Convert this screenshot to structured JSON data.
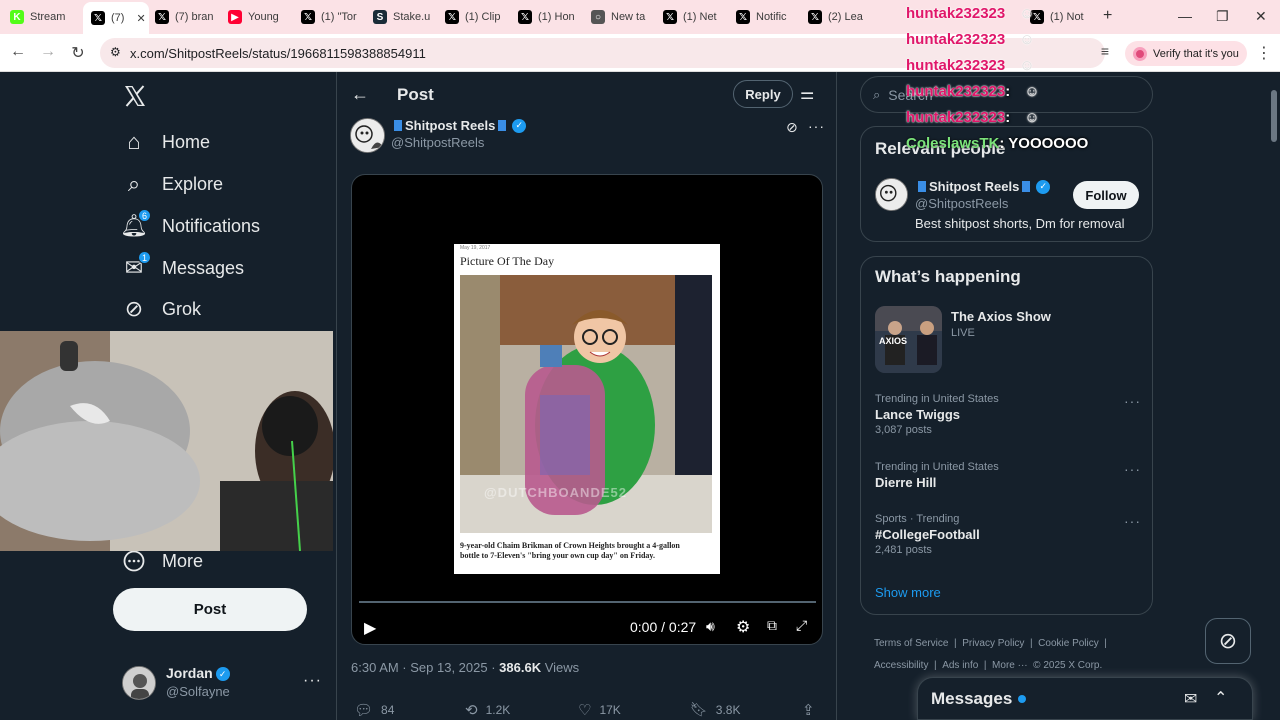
{
  "browser": {
    "tabs": [
      {
        "label": "Stream",
        "icon": "kick-icon",
        "color": "#53fc18"
      },
      {
        "label": "(7)",
        "icon": "x-icon",
        "color": "#000000",
        "active": true
      },
      {
        "label": "(7) bran",
        "icon": "x-icon",
        "color": "#000000"
      },
      {
        "label": "Young",
        "icon": "youtube-icon",
        "color": "#ff0033"
      },
      {
        "label": "(1) \"Tor",
        "icon": "x-icon",
        "color": "#000000"
      },
      {
        "label": "Stake.u",
        "icon": "stake-icon",
        "color": "#1a2c38"
      },
      {
        "label": "(1) Clip",
        "icon": "x-icon",
        "color": "#000000"
      },
      {
        "label": "(1) Hon",
        "icon": "x-icon",
        "color": "#000000"
      },
      {
        "label": "New ta",
        "icon": "chrome-icon",
        "color": "#555555"
      },
      {
        "label": "(1) Net",
        "icon": "x-icon",
        "color": "#000000"
      },
      {
        "label": "Notific",
        "icon": "x-icon",
        "color": "#000000"
      },
      {
        "label": "(2) Lea",
        "icon": "x-icon",
        "color": "#000000"
      },
      {
        "label": "(1) Not",
        "icon": "x-icon",
        "color": "#000000"
      }
    ],
    "url": "x.com/ShitpostReels/status/1966811598388854911",
    "verify_label": "Verify that it's you"
  },
  "nav": {
    "items": [
      {
        "label": "Home",
        "icon": "home-icon"
      },
      {
        "label": "Explore",
        "icon": "search-icon"
      },
      {
        "label": "Notifications",
        "icon": "bell-icon",
        "badge": "6"
      },
      {
        "label": "Messages",
        "icon": "envelope-icon",
        "badge": "1"
      },
      {
        "label": "Grok",
        "icon": "grok-icon"
      }
    ],
    "more_label": "More",
    "post_label": "Post",
    "account": {
      "name": "Jordan",
      "handle": "@Solfayne"
    }
  },
  "post": {
    "header_title": "Post",
    "reply_label": "Reply",
    "author_name": "Shitpost Reels",
    "author_handle": "@ShitpostReels",
    "image": {
      "date": "May 19, 2017",
      "heading": "Picture Of The Day",
      "watermark": "@DUTCHBOANDE52",
      "caption": "9-year-old Chaim Brikman of Crown Heights brought a 4-gallon bottle to 7-Eleven's \"bring your own cup day\" on Friday."
    },
    "video_time": "0:00 / 0:27",
    "timestamp": "6:30 AM · Sep 13, 2025 · ",
    "views_count": "386.6K",
    "views_label": "Views",
    "stats": {
      "replies": "84",
      "reposts": "1.2K",
      "likes": "17K",
      "bookmarks": "3.8K"
    }
  },
  "right": {
    "search_placeholder": "Search",
    "relevant_title": "Relevant people",
    "relevant_person": {
      "name": "Shitpost Reels",
      "handle": "@ShitpostReels",
      "bio": "Best shitpost shorts, Dm for removal",
      "follow_label": "Follow"
    },
    "happening_title": "What’s happening",
    "live_item": {
      "title": "The Axios Show",
      "status": "LIVE",
      "thumb_text": "AXIOS"
    },
    "trends": [
      {
        "context": "Trending in United States",
        "name": "Lance Twiggs",
        "posts": "3,087 posts"
      },
      {
        "context": "Trending in United States",
        "name": "Dierre Hill",
        "posts": ""
      },
      {
        "context": "Sports · Trending",
        "name": "#CollegeFootball",
        "posts": "2,481 posts"
      }
    ],
    "show_more": "Show more",
    "footer": [
      "Terms of Service",
      "Privacy Policy",
      "Cookie Policy",
      "Accessibility",
      "Ads info",
      "More ···",
      "© 2025 X Corp."
    ],
    "messages_title": "Messages"
  },
  "overlay_chat": {
    "lines": [
      {
        "user": "huntak232323",
        "text": ""
      },
      {
        "user": "huntak232323",
        "text": ""
      },
      {
        "user": "huntak232323",
        "text": ""
      },
      {
        "user": "huntak232323",
        "text": ":"
      },
      {
        "user": "huntak232323",
        "text": ":"
      },
      {
        "user": "ColeslawsTK",
        "text": ": YOOOOOO"
      }
    ]
  }
}
